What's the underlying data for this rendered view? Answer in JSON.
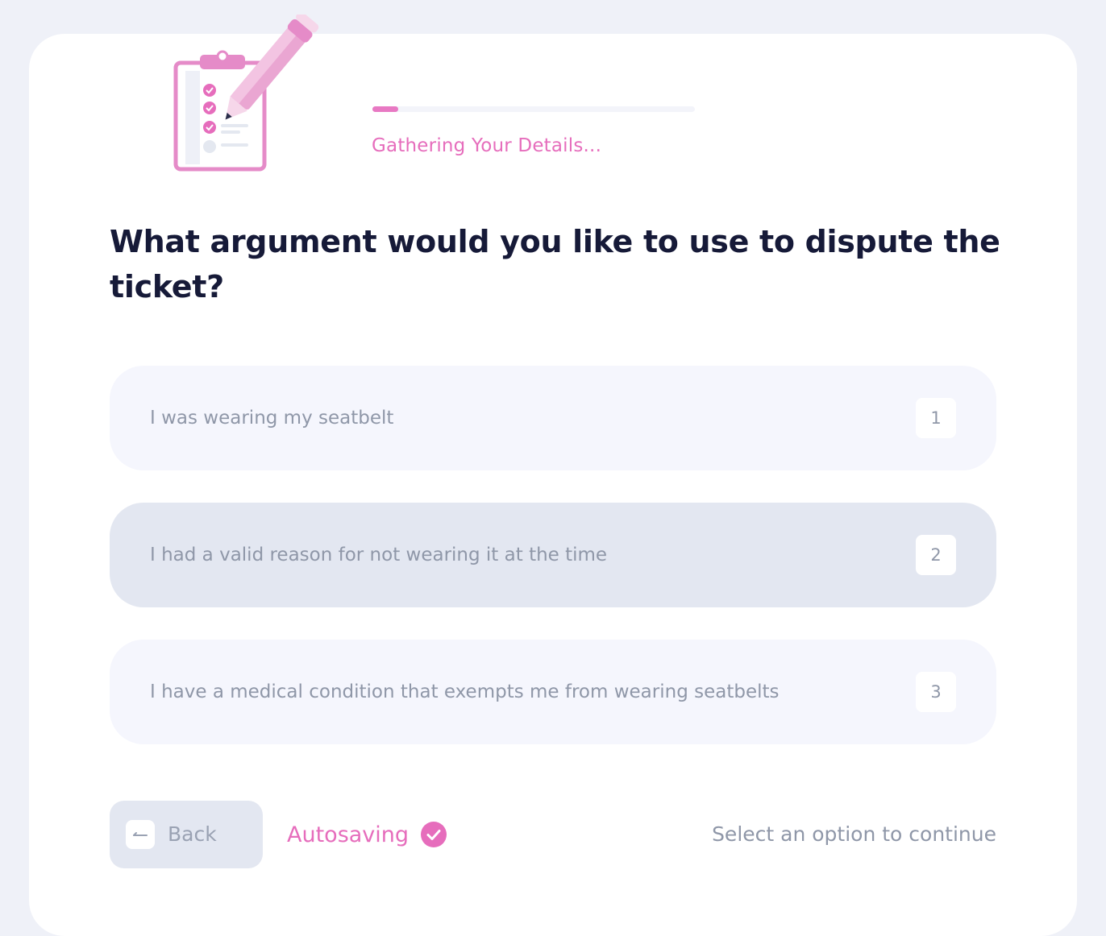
{
  "header": {
    "illustration_icon": "clipboard-pencil-illustration",
    "progress_percent": 8,
    "progress_label": "Gathering Your Details..."
  },
  "question": {
    "text": "What argument would you like to use to dispute the ticket?"
  },
  "options": [
    {
      "label": "I was wearing my seatbelt",
      "key": "1"
    },
    {
      "label": "I had a valid reason for not wearing it at the time",
      "key": "2"
    },
    {
      "label": "I have a medical condition that exempts me from wearing seatbelts",
      "key": "3"
    }
  ],
  "footer": {
    "back_label": "Back",
    "back_icon": "arrow-left-icon",
    "autosave_label": "Autosaving",
    "autosave_icon": "check-circle-icon",
    "hint": "Select an option to continue"
  },
  "colors": {
    "accent_pink": "#e66dbc",
    "heading": "#161a38",
    "muted_text": "#8f97a8",
    "option_bg": "#f5f6fd",
    "option_hover_bg": "#e3e7f1",
    "page_bg": "#eff1f8"
  }
}
